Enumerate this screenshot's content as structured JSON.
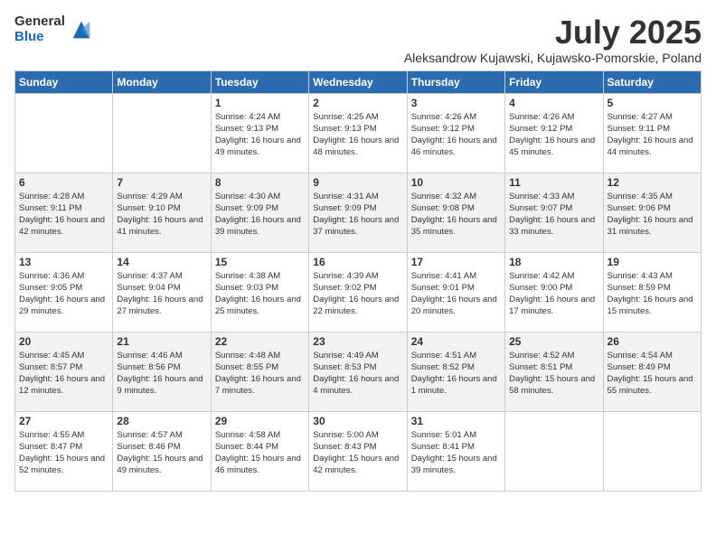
{
  "logo": {
    "general": "General",
    "blue": "Blue"
  },
  "title": "July 2025",
  "location": "Aleksandrow Kujawski, Kujawsko-Pomorskie, Poland",
  "days_of_week": [
    "Sunday",
    "Monday",
    "Tuesday",
    "Wednesday",
    "Thursday",
    "Friday",
    "Saturday"
  ],
  "weeks": [
    [
      {
        "day": "",
        "info": ""
      },
      {
        "day": "",
        "info": ""
      },
      {
        "day": "1",
        "info": "Sunrise: 4:24 AM\nSunset: 9:13 PM\nDaylight: 16 hours and 49 minutes."
      },
      {
        "day": "2",
        "info": "Sunrise: 4:25 AM\nSunset: 9:13 PM\nDaylight: 16 hours and 48 minutes."
      },
      {
        "day": "3",
        "info": "Sunrise: 4:26 AM\nSunset: 9:12 PM\nDaylight: 16 hours and 46 minutes."
      },
      {
        "day": "4",
        "info": "Sunrise: 4:26 AM\nSunset: 9:12 PM\nDaylight: 16 hours and 45 minutes."
      },
      {
        "day": "5",
        "info": "Sunrise: 4:27 AM\nSunset: 9:11 PM\nDaylight: 16 hours and 44 minutes."
      }
    ],
    [
      {
        "day": "6",
        "info": "Sunrise: 4:28 AM\nSunset: 9:11 PM\nDaylight: 16 hours and 42 minutes."
      },
      {
        "day": "7",
        "info": "Sunrise: 4:29 AM\nSunset: 9:10 PM\nDaylight: 16 hours and 41 minutes."
      },
      {
        "day": "8",
        "info": "Sunrise: 4:30 AM\nSunset: 9:09 PM\nDaylight: 16 hours and 39 minutes."
      },
      {
        "day": "9",
        "info": "Sunrise: 4:31 AM\nSunset: 9:09 PM\nDaylight: 16 hours and 37 minutes."
      },
      {
        "day": "10",
        "info": "Sunrise: 4:32 AM\nSunset: 9:08 PM\nDaylight: 16 hours and 35 minutes."
      },
      {
        "day": "11",
        "info": "Sunrise: 4:33 AM\nSunset: 9:07 PM\nDaylight: 16 hours and 33 minutes."
      },
      {
        "day": "12",
        "info": "Sunrise: 4:35 AM\nSunset: 9:06 PM\nDaylight: 16 hours and 31 minutes."
      }
    ],
    [
      {
        "day": "13",
        "info": "Sunrise: 4:36 AM\nSunset: 9:05 PM\nDaylight: 16 hours and 29 minutes."
      },
      {
        "day": "14",
        "info": "Sunrise: 4:37 AM\nSunset: 9:04 PM\nDaylight: 16 hours and 27 minutes."
      },
      {
        "day": "15",
        "info": "Sunrise: 4:38 AM\nSunset: 9:03 PM\nDaylight: 16 hours and 25 minutes."
      },
      {
        "day": "16",
        "info": "Sunrise: 4:39 AM\nSunset: 9:02 PM\nDaylight: 16 hours and 22 minutes."
      },
      {
        "day": "17",
        "info": "Sunrise: 4:41 AM\nSunset: 9:01 PM\nDaylight: 16 hours and 20 minutes."
      },
      {
        "day": "18",
        "info": "Sunrise: 4:42 AM\nSunset: 9:00 PM\nDaylight: 16 hours and 17 minutes."
      },
      {
        "day": "19",
        "info": "Sunrise: 4:43 AM\nSunset: 8:59 PM\nDaylight: 16 hours and 15 minutes."
      }
    ],
    [
      {
        "day": "20",
        "info": "Sunrise: 4:45 AM\nSunset: 8:57 PM\nDaylight: 16 hours and 12 minutes."
      },
      {
        "day": "21",
        "info": "Sunrise: 4:46 AM\nSunset: 8:56 PM\nDaylight: 16 hours and 9 minutes."
      },
      {
        "day": "22",
        "info": "Sunrise: 4:48 AM\nSunset: 8:55 PM\nDaylight: 16 hours and 7 minutes."
      },
      {
        "day": "23",
        "info": "Sunrise: 4:49 AM\nSunset: 8:53 PM\nDaylight: 16 hours and 4 minutes."
      },
      {
        "day": "24",
        "info": "Sunrise: 4:51 AM\nSunset: 8:52 PM\nDaylight: 16 hours and 1 minute."
      },
      {
        "day": "25",
        "info": "Sunrise: 4:52 AM\nSunset: 8:51 PM\nDaylight: 15 hours and 58 minutes."
      },
      {
        "day": "26",
        "info": "Sunrise: 4:54 AM\nSunset: 8:49 PM\nDaylight: 15 hours and 55 minutes."
      }
    ],
    [
      {
        "day": "27",
        "info": "Sunrise: 4:55 AM\nSunset: 8:47 PM\nDaylight: 15 hours and 52 minutes."
      },
      {
        "day": "28",
        "info": "Sunrise: 4:57 AM\nSunset: 8:46 PM\nDaylight: 15 hours and 49 minutes."
      },
      {
        "day": "29",
        "info": "Sunrise: 4:58 AM\nSunset: 8:44 PM\nDaylight: 15 hours and 46 minutes."
      },
      {
        "day": "30",
        "info": "Sunrise: 5:00 AM\nSunset: 8:43 PM\nDaylight: 15 hours and 42 minutes."
      },
      {
        "day": "31",
        "info": "Sunrise: 5:01 AM\nSunset: 8:41 PM\nDaylight: 15 hours and 39 minutes."
      },
      {
        "day": "",
        "info": ""
      },
      {
        "day": "",
        "info": ""
      }
    ]
  ]
}
